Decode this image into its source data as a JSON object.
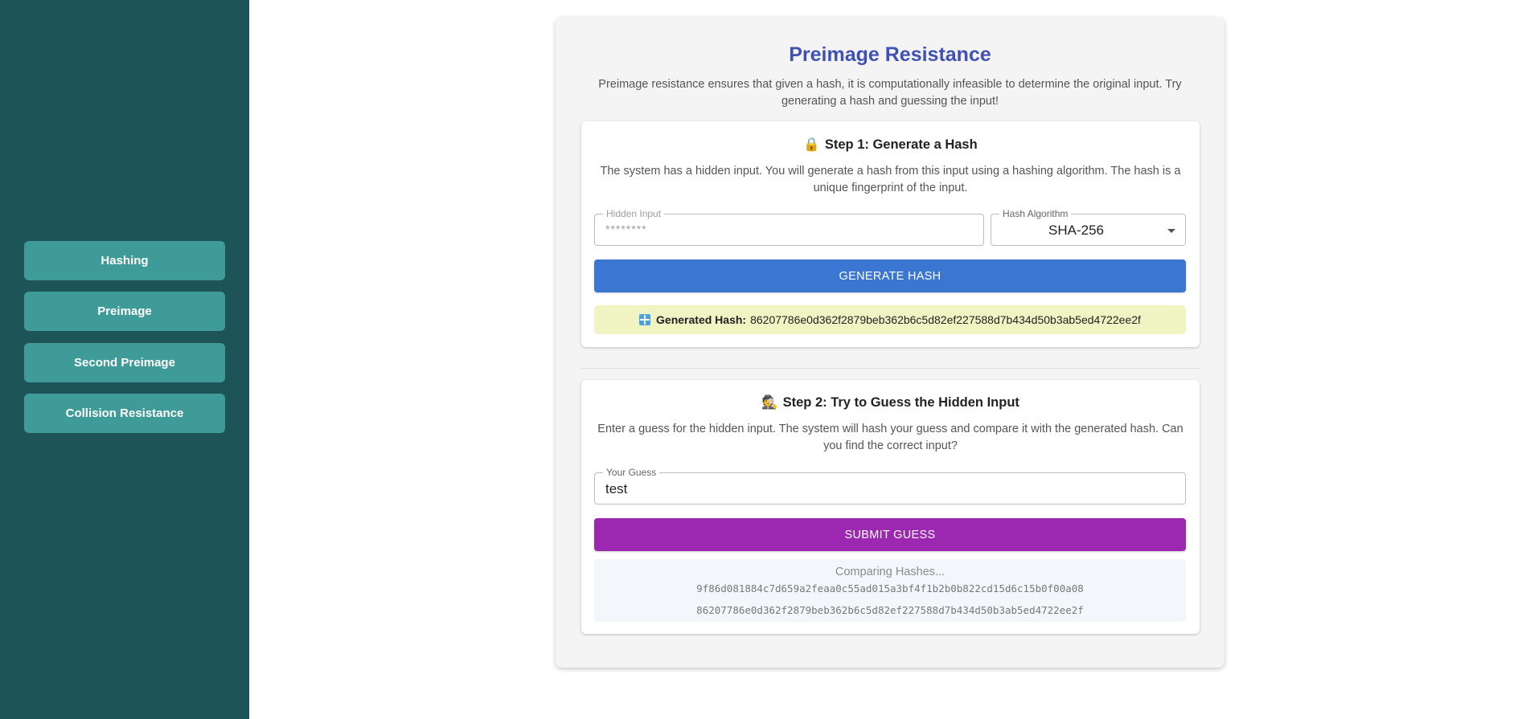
{
  "sidebar": {
    "items": [
      {
        "label": "Hashing"
      },
      {
        "label": "Preimage"
      },
      {
        "label": "Second Preimage"
      },
      {
        "label": "Collision Resistance"
      }
    ]
  },
  "page": {
    "title": "Preimage Resistance",
    "intro": "Preimage resistance ensures that given a hash, it is computationally infeasible to determine the original input. Try generating a hash and guessing the input!"
  },
  "step1": {
    "emoji": "🔒",
    "title": "Step 1: Generate a Hash",
    "description": "The system has a hidden input. You will generate a hash from this input using a hashing algorithm. The hash is a unique fingerprint of the input.",
    "hidden_input_label": "Hidden Input",
    "hidden_input_placeholder": "********",
    "algorithm_label": "Hash Algorithm",
    "algorithm_value": "SHA-256",
    "generate_button": "GENERATE HASH",
    "generated_label": "Generated Hash:",
    "generated_hash": "86207786e0d362f2879beb362b6c5d82ef227588d7b434d50b3ab5ed4722ee2f"
  },
  "step2": {
    "emoji": "🕵️",
    "title": "Step 2: Try to Guess the Hidden Input",
    "description": "Enter a guess for the hidden input. The system will hash your guess and compare it with the generated hash. Can you find the correct input?",
    "guess_label": "Your Guess",
    "guess_value": "test",
    "submit_button": "SUBMIT GUESS",
    "comparing_title": "Comparing Hashes...",
    "guess_hash": "9f86d081884c7d659a2feaa0c55ad015a3bf4f1b2b0b822cd15d6c15b0f00a08",
    "target_hash": "86207786e0d362f2879beb362b6c5d82ef227588d7b434d50b3ab5ed4722ee2f"
  },
  "colors": {
    "sidebar_bg": "#1d5458",
    "nav_button_bg": "#3f9b97",
    "title": "#3f51b5",
    "generate_button": "#3a76d2",
    "submit_button": "#9c27b0",
    "hash_box_bg": "#f0f4c3",
    "compare_box_bg": "#f3f7fc"
  }
}
